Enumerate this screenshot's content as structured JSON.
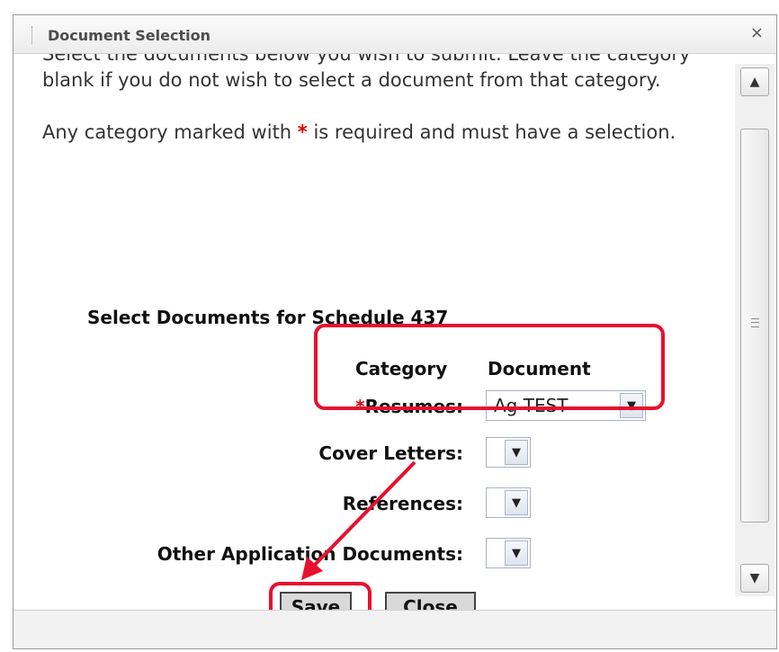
{
  "dialog": {
    "title": "Document Selection",
    "close_glyph": "×",
    "instructions": {
      "line1": "Select the documents below you wish to submit. Leave the category blank if you do not wish to select a document from that category.",
      "line2_before": "Any category marked with ",
      "line2_asterisk": "*",
      "line2_after": " is required and must have a selection."
    },
    "section_title": "Select Documents for Schedule 437",
    "table": {
      "header_category": "Category",
      "header_document": "Document",
      "rows": [
        {
          "label": "Resumes:",
          "required": true,
          "required_mark": "*",
          "value": "Ag TEST"
        },
        {
          "label": "Cover Letters:",
          "required": false,
          "value": ""
        },
        {
          "label": "References:",
          "required": false,
          "value": ""
        },
        {
          "label": "Other Application Documents:",
          "required": false,
          "value": ""
        }
      ]
    },
    "buttons": {
      "save": "Save",
      "close": "Close"
    },
    "scrollbar": {
      "up_icon": "chevron-up-icon",
      "down_icon": "chevron-down-icon"
    },
    "annotation_color": "#e8102d"
  }
}
